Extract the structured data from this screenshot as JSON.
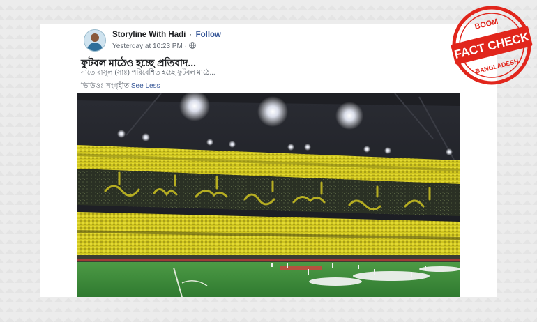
{
  "post": {
    "author": "Storyline With Hadi",
    "separator": "·",
    "follow_label": "Follow",
    "timestamp": "Yesterday at 10:23 PM",
    "timestamp_separator": "·",
    "headline": "ফুটবল মাঠেও হচ্ছে প্রতিবাদ...",
    "subline": "নাতে রাসুল (সাঃ) পরিবেশিত হচ্ছে ফুটবল মাঠে...",
    "credit": "ভিডিওঃ সংগৃহীত",
    "see_less_label": "See Less"
  },
  "badge": {
    "top_text": "BOOM",
    "main_text": "FACT CHECK",
    "bottom_text": "BANGLADESH",
    "color": "#e1261c"
  },
  "icons": {
    "visibility": "globe-icon",
    "avatar": "avatar"
  },
  "colors": {
    "link": "#385898",
    "stadium_yellow": "#d9cf22",
    "pitch_green": "#3d8a3a"
  }
}
